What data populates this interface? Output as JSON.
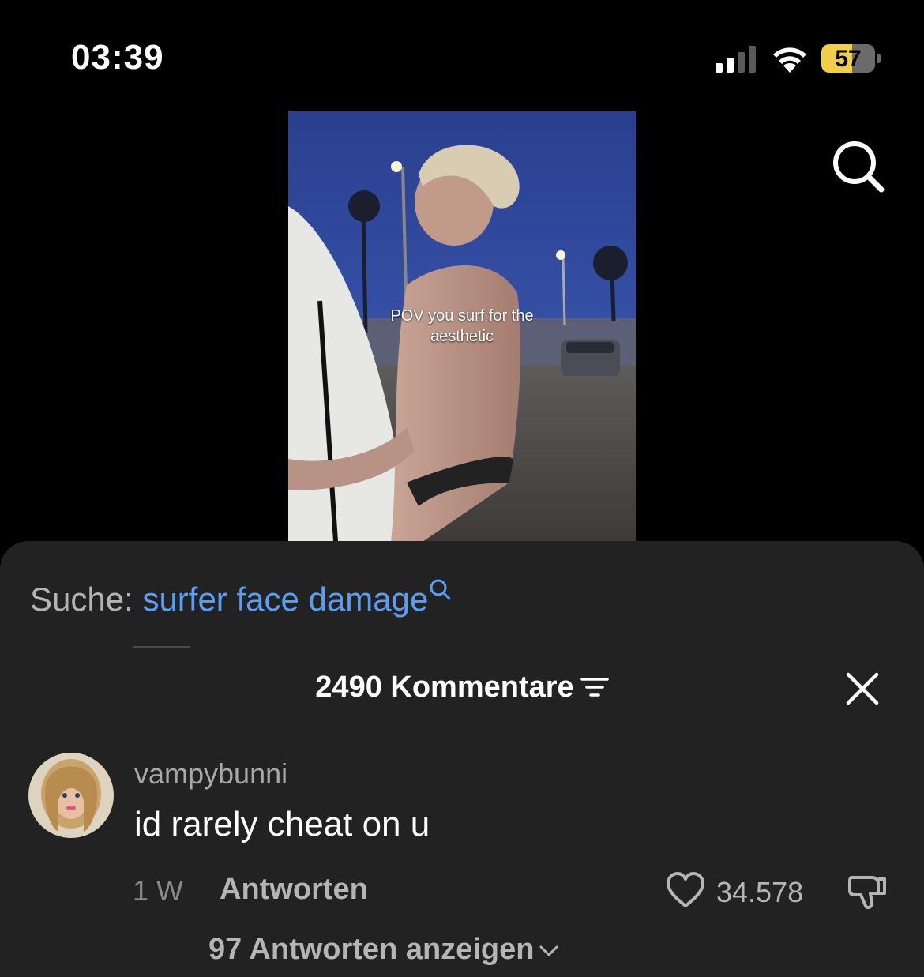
{
  "status_bar": {
    "time": "03:39",
    "battery_level": "57",
    "icons": [
      "signal-icon",
      "wifi-icon",
      "battery-icon"
    ]
  },
  "video": {
    "caption_line1": "POV you surf for the",
    "caption_line2": "aesthetic"
  },
  "search": {
    "prefix": "Suche: ",
    "term": "surfer face damage"
  },
  "comments": {
    "header": "2490 Kommentare",
    "items": [
      {
        "username": "vampybunni",
        "text": "id rarely cheat on u",
        "age": "1 W",
        "reply_label": "Antworten",
        "likes": "34.578",
        "view_replies": "97 Antworten anzeigen"
      }
    ]
  },
  "colors": {
    "sheet_bg": "#222222",
    "link_blue": "#5a9ef4",
    "battery_yellow": "#f2cf4a"
  }
}
